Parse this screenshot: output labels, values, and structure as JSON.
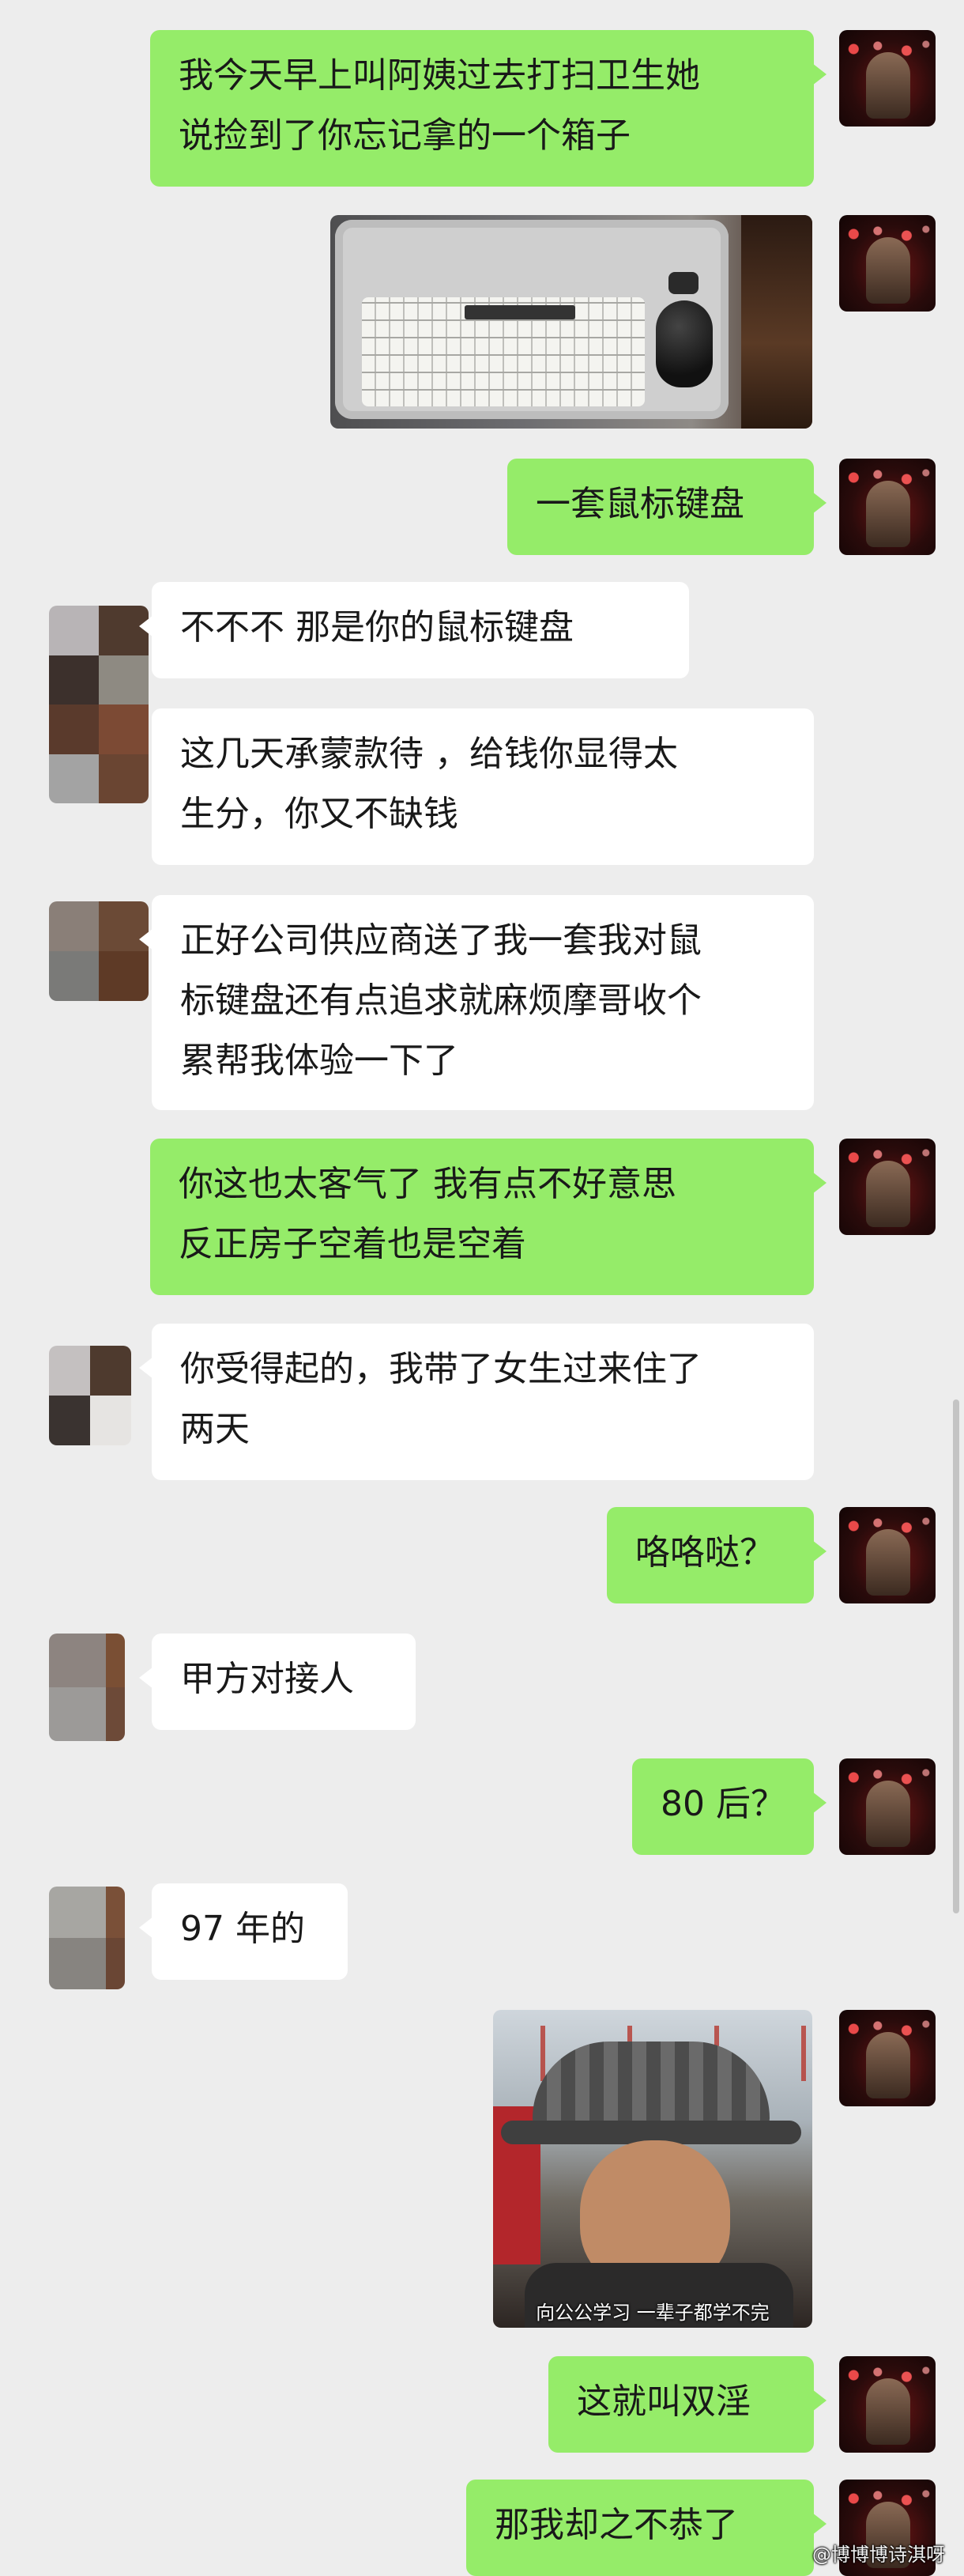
{
  "colors": {
    "background": "#ededed",
    "self_bubble": "#95ec69",
    "other_bubble": "#ffffff",
    "text": "#191919"
  },
  "messages": [
    {
      "sender": "me",
      "type": "text",
      "text": "我今天早上叫阿姨过去打扫卫生她\n说捡到了你忘记拿的一个箱子"
    },
    {
      "sender": "me",
      "type": "image",
      "description_icon": "keyboard-mouse-photo"
    },
    {
      "sender": "me",
      "type": "text",
      "text": "一套鼠标键盘"
    },
    {
      "sender": "other",
      "type": "text",
      "text": "不不不 那是你的鼠标键盘"
    },
    {
      "sender": "other",
      "type": "text",
      "text": "这几天承蒙款待 ，给钱你显得太\n生分，你又不缺钱"
    },
    {
      "sender": "other",
      "type": "text",
      "text": "正好公司供应商送了我一套我对鼠\n标键盘还有点追求就麻烦摩哥收个\n累帮我体验一下了"
    },
    {
      "sender": "me",
      "type": "text",
      "text": "你这也太客气了 我有点不好意思\n反正房子空着也是空着"
    },
    {
      "sender": "other",
      "type": "text",
      "text": "你受得起的，我带了女生过来住了\n两天"
    },
    {
      "sender": "me",
      "type": "text",
      "text": "咯咯哒？"
    },
    {
      "sender": "other",
      "type": "text",
      "text": "甲方对接人"
    },
    {
      "sender": "me",
      "type": "text",
      "text": "80 后？"
    },
    {
      "sender": "other",
      "type": "text",
      "text": "97 年的"
    },
    {
      "sender": "me",
      "type": "image",
      "caption": "向公公学习 一辈子都学不完"
    },
    {
      "sender": "me",
      "type": "text",
      "text": "这就叫双淫"
    },
    {
      "sender": "me",
      "type": "text",
      "text": "那我却之不恭了"
    }
  ],
  "watermark": "@博博博诗淇呀"
}
